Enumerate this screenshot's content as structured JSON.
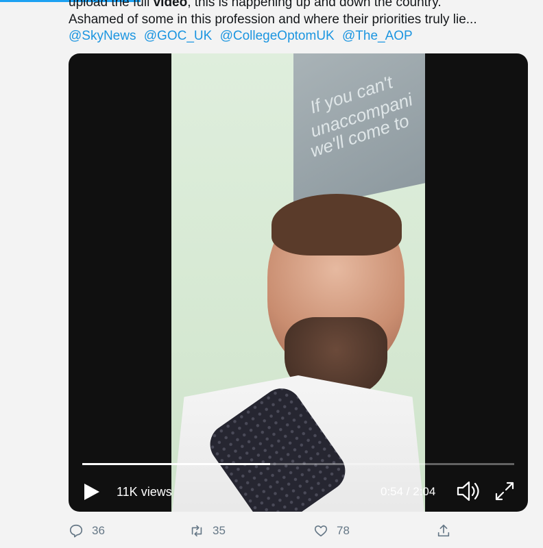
{
  "tweet": {
    "line1_pre": "upload the full ",
    "line1_bold": "video",
    "line1_post": ", this is happening up and down the country.",
    "line2": "Ashamed of some in this profession and where their priorities truly lie...",
    "mentions": [
      "@SkyNews",
      "@GOC_UK",
      "@CollegeOptomUK",
      "@The_AOP"
    ]
  },
  "video": {
    "poster_lines": [
      "If you can't",
      "unaccompani",
      "we'll come to"
    ],
    "views": "11K views",
    "time": "0:54 / 2:04",
    "progress_fraction": 0.435
  },
  "actions": {
    "replies": "36",
    "retweets": "35",
    "likes": "78"
  },
  "colors": {
    "link": "#1b95e0",
    "accent": "#1da1f2",
    "action": "#657786"
  }
}
